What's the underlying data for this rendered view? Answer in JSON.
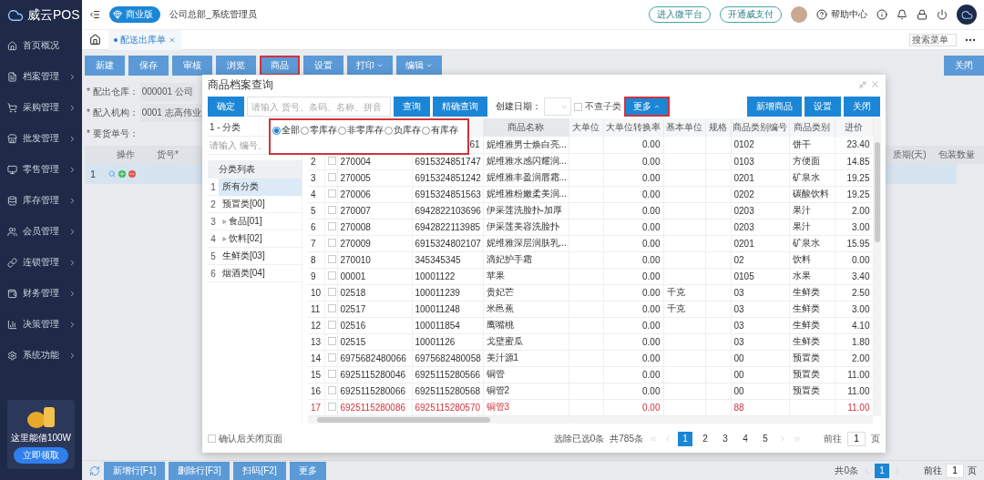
{
  "sidebar": {
    "logo": "威云POS",
    "items": [
      {
        "label": "首页概况",
        "expandable": false
      },
      {
        "label": "档案管理",
        "expandable": true
      },
      {
        "label": "采购管理",
        "expandable": true
      },
      {
        "label": "批发管理",
        "expandable": true
      },
      {
        "label": "零售管理",
        "expandable": true
      },
      {
        "label": "库存管理",
        "expandable": true
      },
      {
        "label": "会员管理",
        "expandable": true
      },
      {
        "label": "连锁管理",
        "expandable": true
      },
      {
        "label": "财务管理",
        "expandable": true
      },
      {
        "label": "决策管理",
        "expandable": true
      },
      {
        "label": "系统功能",
        "expandable": true
      }
    ],
    "promo": {
      "text": "这里能借100W",
      "button": "立即领取"
    }
  },
  "header": {
    "edition": "商业版",
    "user": "公司总部_系统管理员",
    "links": [
      "进入微平台",
      "开通威支付"
    ],
    "help": "帮助中心"
  },
  "tab_bar": {
    "tabs": [
      {
        "label": "配送出库单",
        "selected": true
      }
    ],
    "search": {
      "placeholder": "搜索菜单"
    }
  },
  "toolbar": {
    "buttons": [
      {
        "label": "新建",
        "highlighted": false,
        "dropdown": false
      },
      {
        "label": "保存",
        "highlighted": false,
        "dropdown": false
      },
      {
        "label": "审核",
        "highlighted": false,
        "dropdown": false
      },
      {
        "label": "浏览",
        "highlighted": false,
        "dropdown": false
      },
      {
        "label": "商品",
        "highlighted": true,
        "dropdown": false
      },
      {
        "label": "设置",
        "highlighted": false,
        "dropdown": false
      },
      {
        "label": "打印",
        "highlighted": false,
        "dropdown": true
      },
      {
        "label": "编辑",
        "highlighted": false,
        "dropdown": true
      }
    ],
    "close": "关闭"
  },
  "form": {
    "fields": [
      {
        "label": "* 配出仓库：",
        "value": "000001 公司"
      },
      {
        "label": "* 配入机构：",
        "value": "0001 志高伟业"
      },
      {
        "label": "* 要货单号："
      }
    ]
  },
  "grid": {
    "columns_left": [
      "操作",
      "货号*"
    ],
    "columns_right": [
      "质期(天)",
      "包装数量"
    ],
    "rows": [
      {
        "index": "1",
        "selected": true
      }
    ]
  },
  "dialog": {
    "title": "商品档案查询",
    "confirm": "确定",
    "search": {
      "placeholder": "请输入 货号、条码、名称、拼音"
    },
    "query": "查询",
    "exact_query": "精确查询",
    "date_label": "创建日期：",
    "no_subcategory": {
      "label": "不查子类",
      "checked": false
    },
    "more": {
      "label": "更多",
      "expanded": true,
      "highlighted": true
    },
    "actions": [
      "新增商品",
      "设置",
      "关闭"
    ],
    "stock_filter": [
      {
        "label": "全部",
        "selected": true
      },
      {
        "label": "零库存",
        "selected": false
      },
      {
        "label": "非零库存",
        "selected": false
      },
      {
        "label": "负库存",
        "selected": false
      },
      {
        "label": "有库存",
        "selected": false
      }
    ],
    "category_panel": {
      "title": "1 - 分类",
      "search": {
        "placeholder": "请输入 编号、"
      },
      "header": "分类列表",
      "items": [
        {
          "index": "1",
          "label": "所有分类",
          "selected": true,
          "expandable": false
        },
        {
          "index": "2",
          "label": "预置类[00]",
          "selected": false,
          "expandable": false
        },
        {
          "index": "3",
          "label": "食品[01]",
          "selected": false,
          "expandable": true
        },
        {
          "index": "4",
          "label": "饮料[02]",
          "selected": false,
          "expandable": true
        },
        {
          "index": "5",
          "label": "生鲜类[03]",
          "selected": false,
          "expandable": false
        },
        {
          "index": "6",
          "label": "烟酒类[04]",
          "selected": false,
          "expandable": false
        }
      ]
    },
    "table": {
      "columns": [
        "商品名称",
        "大单位",
        "大单位转换率",
        "基本单位",
        "规格",
        "商品类别编号",
        "商品类别",
        "进价"
      ],
      "rows": [
        {
          "barcode": "61",
          "name": "妮维雅男士焕白亮...",
          "ratio": "0.00",
          "category_code": "0102",
          "category": "饼干",
          "price": "23.40",
          "alert": false
        },
        {
          "index": "2",
          "code": "270004",
          "barcode": "6915324851747",
          "name": "妮维雅水感闪耀润...",
          "ratio": "0.00",
          "category_code": "0103",
          "category": "方便面",
          "price": "14.85",
          "checked": false,
          "alert": false
        },
        {
          "index": "3",
          "code": "270005",
          "barcode": "6915324851242",
          "name": "妮维雅丰盈润唇霜...",
          "ratio": "0.00",
          "category_code": "0201",
          "category": "矿泉水",
          "price": "19.25",
          "checked": false,
          "alert": false
        },
        {
          "index": "4",
          "code": "270006",
          "barcode": "6915324851563",
          "name": "妮维雅粉嫩柔美润...",
          "ratio": "0.00",
          "category_code": "0202",
          "category": "碳酸饮料",
          "price": "19.25",
          "checked": false,
          "alert": false
        },
        {
          "index": "5",
          "code": "270007",
          "barcode": "6942822103696",
          "name": "伊采莲洗脸扑-加厚",
          "ratio": "0.00",
          "category_code": "0203",
          "category": "果汁",
          "price": "2.00",
          "checked": false,
          "alert": false
        },
        {
          "index": "6",
          "code": "270008",
          "barcode": "6942822113985",
          "name": "伊采莲美容洗脸扑",
          "ratio": "0.00",
          "category_code": "0203",
          "category": "果汁",
          "price": "3.00",
          "checked": false,
          "alert": false
        },
        {
          "index": "7",
          "code": "270009",
          "barcode": "6915324802107",
          "name": "妮维雅深层润肤乳...",
          "ratio": "0.00",
          "category_code": "0201",
          "category": "矿泉水",
          "price": "15.95",
          "checked": false,
          "alert": false
        },
        {
          "index": "8",
          "code": "270010",
          "barcode": "345345345",
          "name": "滴妃护手霜",
          "ratio": "0.00",
          "category_code": "02",
          "category": "饮料",
          "price": "0.00",
          "checked": false,
          "alert": false
        },
        {
          "index": "9",
          "code": "00001",
          "barcode": "10001122",
          "name": "苹果",
          "ratio": "0.00",
          "category_code": "0105",
          "category": "水果",
          "price": "3.40",
          "checked": false,
          "alert": false
        },
        {
          "index": "10",
          "code": "02518",
          "barcode": "100011239",
          "name": "贵妃芒",
          "ratio": "0.00",
          "base_unit": "千克",
          "category_code": "03",
          "category": "生鲜类",
          "price": "2.50",
          "checked": false,
          "alert": false
        },
        {
          "index": "11",
          "code": "02517",
          "barcode": "100011248",
          "name": "米邑蕉",
          "ratio": "0.00",
          "base_unit": "千克",
          "category_code": "03",
          "category": "生鲜类",
          "price": "3.00",
          "checked": false,
          "alert": false
        },
        {
          "index": "12",
          "code": "02516",
          "barcode": "100011854",
          "name": "鹰嘴桃",
          "ratio": "0.00",
          "category_code": "03",
          "category": "生鲜类",
          "price": "4.10",
          "checked": false,
          "alert": false
        },
        {
          "index": "13",
          "code": "02515",
          "barcode": "10001126",
          "name": "戈壁蜜瓜",
          "ratio": "0.00",
          "category_code": "03",
          "category": "生鲜类",
          "price": "1.80",
          "checked": false,
          "alert": false
        },
        {
          "index": "14",
          "code": "6975682480066",
          "barcode": "6975682480058",
          "name": "美汁源1",
          "ratio": "0.00",
          "category_code": "00",
          "category": "预置类",
          "price": "2.00",
          "checked": false,
          "alert": false
        },
        {
          "index": "15",
          "code": "6925115280046",
          "barcode": "6925115280566",
          "name": "铜管",
          "ratio": "0.00",
          "category_code": "00",
          "category": "预置类",
          "price": "11.00",
          "checked": false,
          "alert": false
        },
        {
          "index": "16",
          "code": "6925115280066",
          "barcode": "6925115280568",
          "name": "铜管2",
          "ratio": "0.00",
          "category_code": "00",
          "category": "预置类",
          "price": "11.00",
          "checked": false,
          "alert": false
        },
        {
          "index": "17",
          "code": "6925115280086",
          "barcode": "6925115280570",
          "name": "铜管3",
          "ratio": "0.00",
          "category_code": "88",
          "price": "11.00",
          "checked": false,
          "alert": true
        }
      ]
    },
    "footer": {
      "close_after_confirm": {
        "label": "确认后关闭页面",
        "checked": false
      },
      "selected_info": "选除已选0条",
      "total": "共785条",
      "pages": [
        {
          "label": "1",
          "selected": true
        },
        {
          "label": "2",
          "selected": false
        },
        {
          "label": "3",
          "selected": false
        },
        {
          "label": "4",
          "selected": false
        },
        {
          "label": "5",
          "selected": false
        }
      ],
      "goto_label": "前往",
      "goto_value": "1",
      "page_suffix": "页"
    }
  },
  "bottom_bar": {
    "buttons": [
      "新增行[F1]",
      "删除行[F3]",
      "扫码[F2]",
      "更多"
    ],
    "count": "共0条",
    "pages": [
      {
        "label": "1",
        "selected": true
      }
    ],
    "goto_label": "前往",
    "goto_value": "1",
    "page_suffix": "页"
  }
}
